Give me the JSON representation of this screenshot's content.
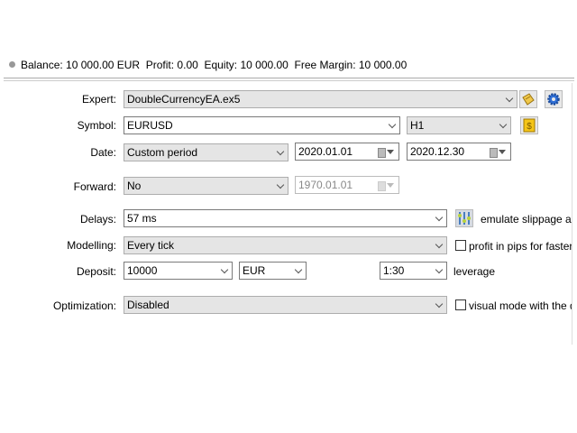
{
  "status": {
    "text": "Balance: 10 000.00 EUR  Profit: 0.00  Equity: 10 000.00  Free Margin: 10 000.00"
  },
  "form": {
    "expert": {
      "label": "Expert:",
      "value": "DoubleCurrencyEA.ex5"
    },
    "symbol": {
      "label": "Symbol:",
      "value": "EURUSD",
      "timeframe": "H1"
    },
    "date": {
      "label": "Date:",
      "period": "Custom period",
      "from": "2020.01.01",
      "to": "2020.12.30"
    },
    "forward": {
      "label": "Forward:",
      "value": "No",
      "date": "1970.01.01"
    },
    "delays": {
      "label": "Delays:",
      "value": "57 ms",
      "note": "emulate slippage and"
    },
    "modelling": {
      "label": "Modelling:",
      "value": "Every tick",
      "checkbox_label": "profit in pips for faster ca",
      "checked": false
    },
    "deposit": {
      "label": "Deposit:",
      "value": "10000",
      "currency": "EUR",
      "leverage": "1:30",
      "leverage_label": "leverage"
    },
    "optimization": {
      "label": "Optimization:",
      "value": "Disabled",
      "checkbox_label": "visual mode with the disp",
      "checked": false
    }
  }
}
